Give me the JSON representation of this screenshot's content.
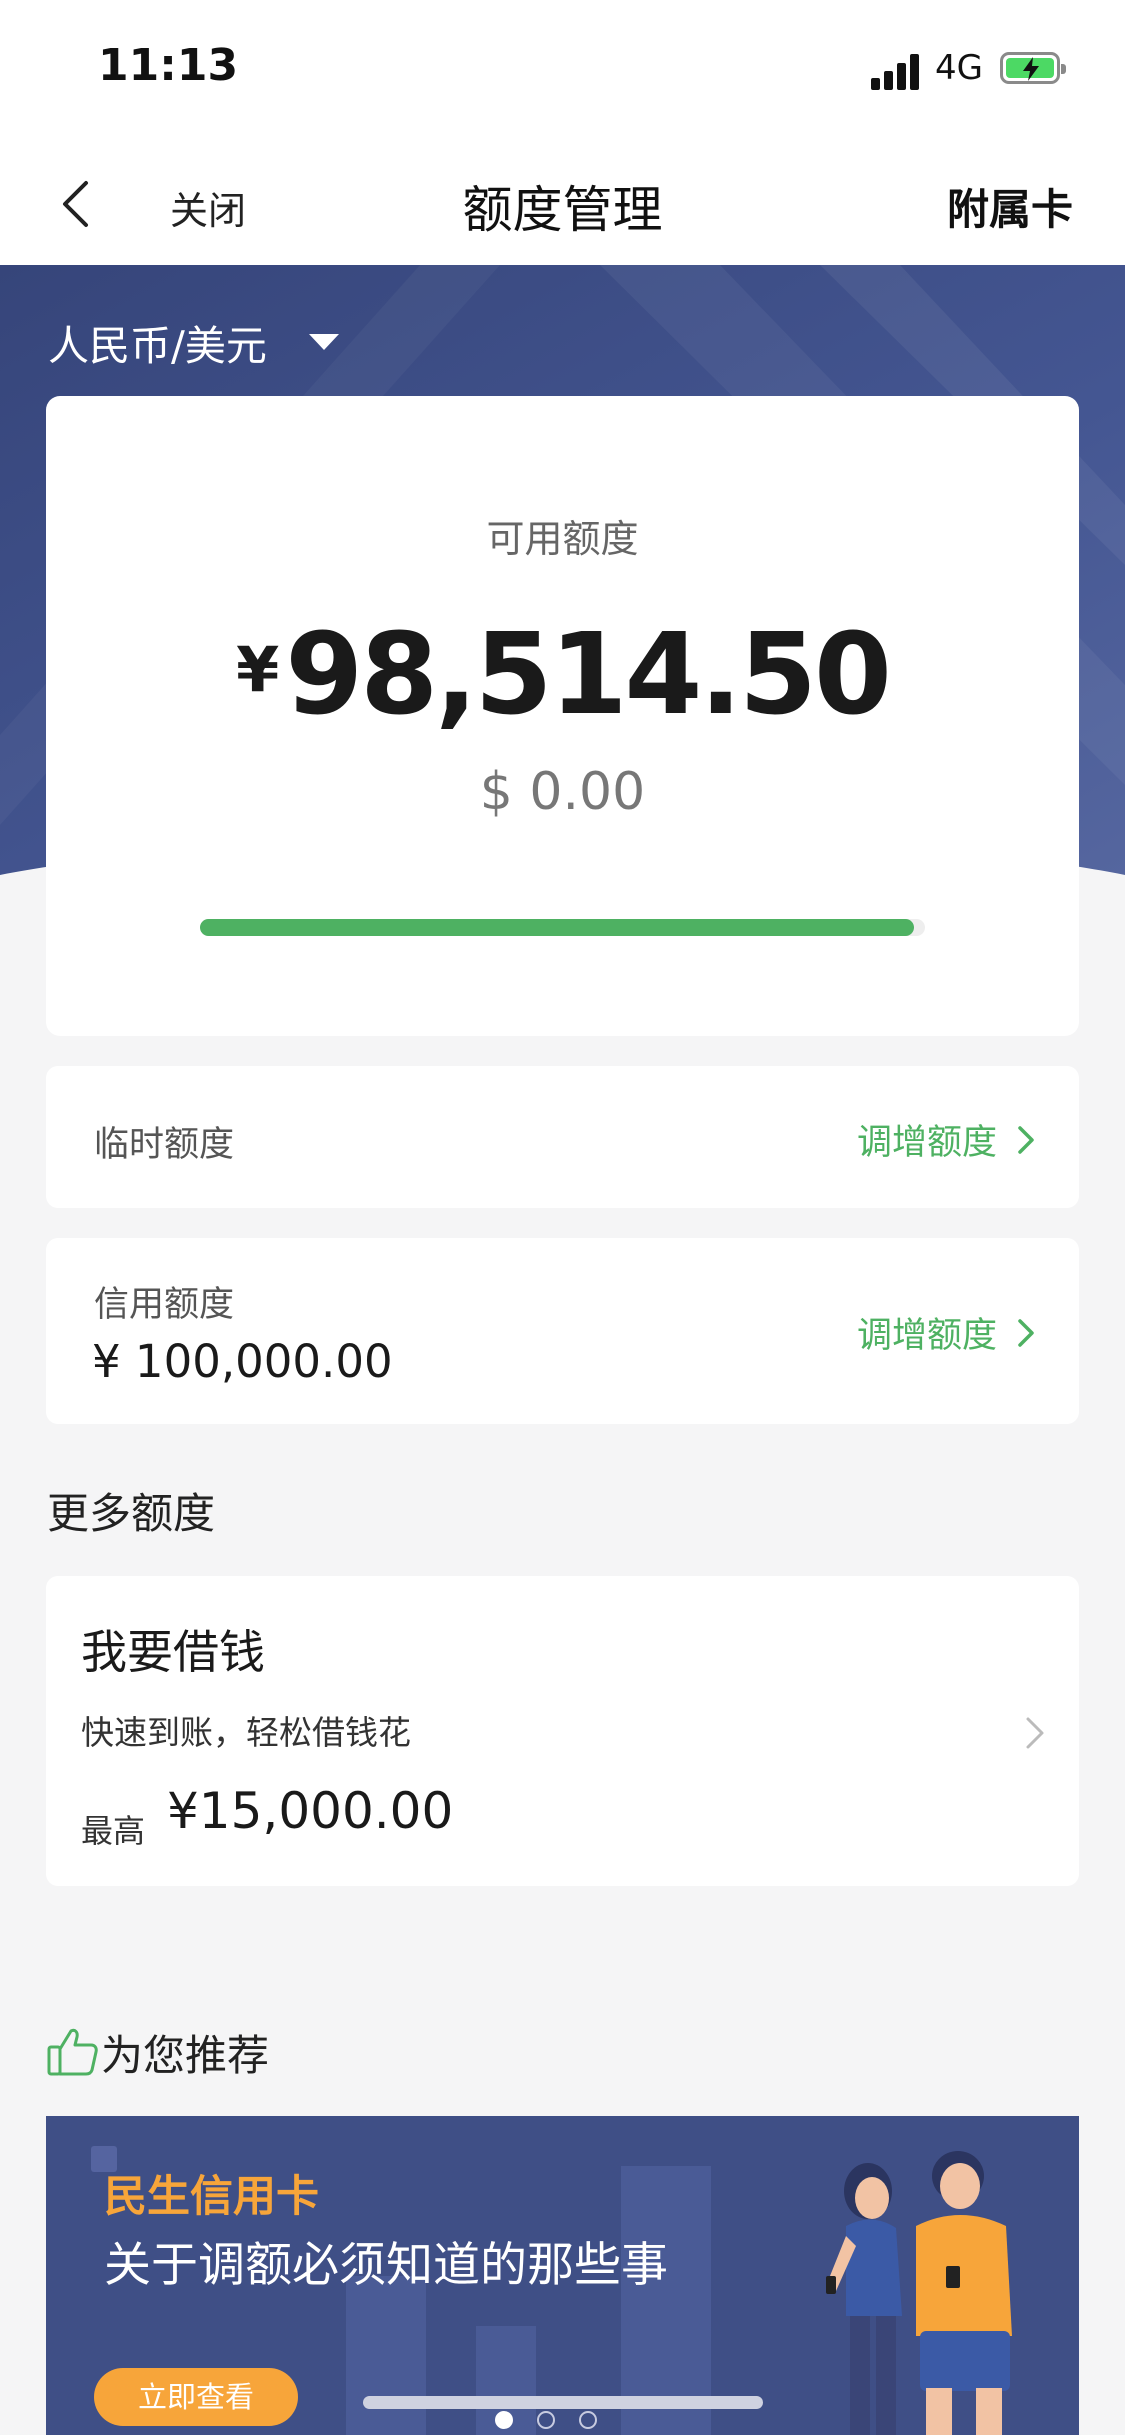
{
  "status_bar": {
    "time": "11:13",
    "network": "4G"
  },
  "nav": {
    "close_label": "关闭",
    "title": "额度管理",
    "right_link": "附属卡"
  },
  "currency_selector": {
    "label": "人民币/美元"
  },
  "available": {
    "label": "可用额度",
    "yen_symbol": "¥",
    "amount": "98,514.50",
    "usd": "$ 0.00",
    "usage_fraction": 0.985
  },
  "temp_limit": {
    "label": "临时额度",
    "action": "调增额度"
  },
  "credit_limit": {
    "label": "信用额度",
    "amount": "¥ 100,000.00",
    "action": "调增额度"
  },
  "more": {
    "title": "更多额度"
  },
  "borrow": {
    "title": "我要借钱",
    "subtitle": "快速到账，轻松借钱花",
    "max_label": "最高",
    "max_amount": "¥15,000.00"
  },
  "recommend": {
    "title": "为您推荐"
  },
  "banner": {
    "brand": "民生信用卡",
    "headline": "关于调额必须知道的那些事",
    "button": "立即查看",
    "page_count": 3,
    "active_page": 1
  },
  "colors": {
    "accent_green": "#4eb162",
    "hero_navy": "#3f4f86",
    "banner_orange": "#f7a53a"
  }
}
